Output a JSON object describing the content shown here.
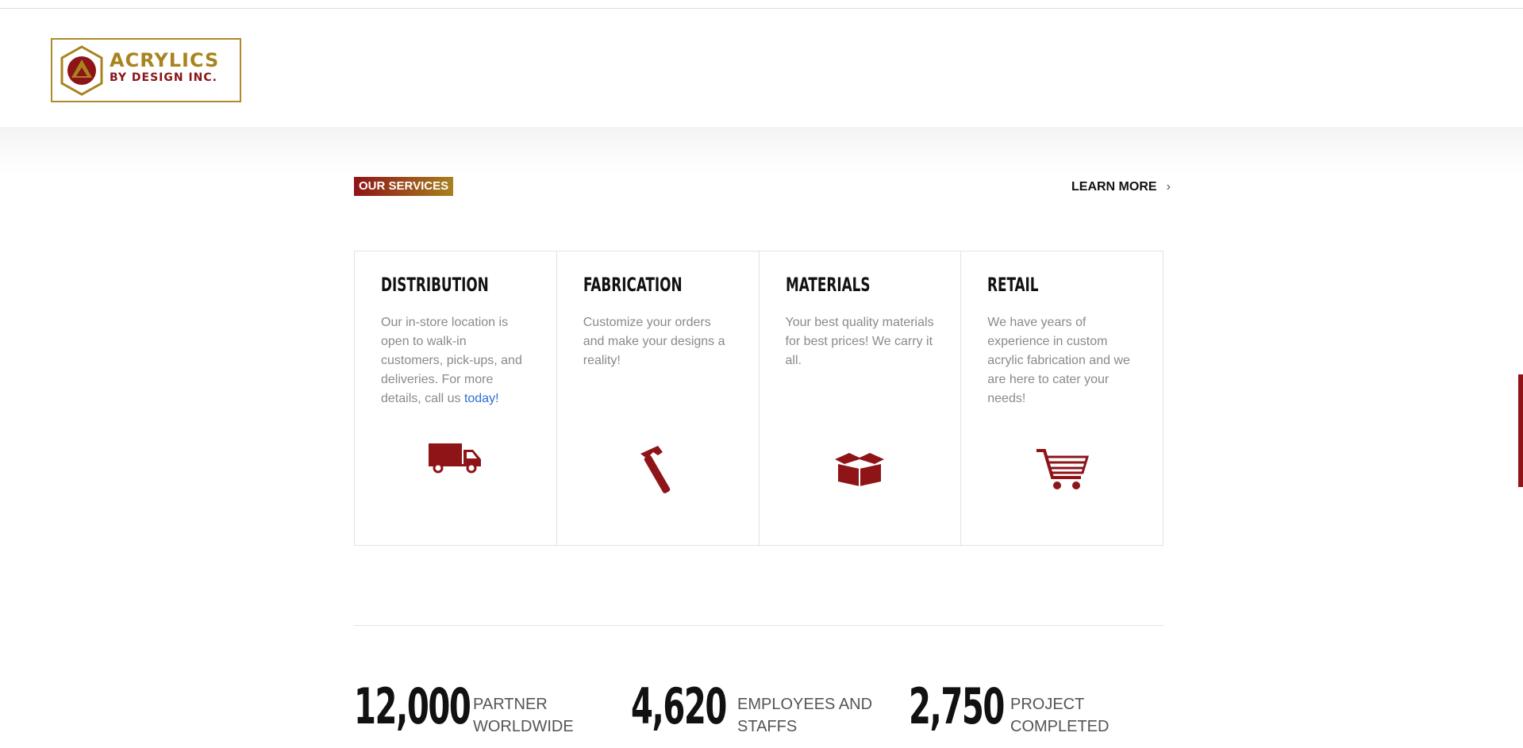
{
  "header": {
    "logo": {
      "line1": "ACRYLICS",
      "line2": "BY DESIGN INC."
    }
  },
  "services": {
    "badge": "OUR SERVICES",
    "learn_more": "LEARN MORE",
    "cards": [
      {
        "title": "DISTRIBUTION",
        "desc": "Our in-store location is open to walk-in customers, pick-ups, and deliveries. For more details, call us ",
        "link": "today!",
        "icon": "truck-icon"
      },
      {
        "title": "FABRICATION",
        "desc": "Customize your orders and make your designs a reality!",
        "icon": "hammer-icon"
      },
      {
        "title": "MATERIALS",
        "desc": "Your best quality materials for best prices! We carry it all.",
        "icon": "box-icon"
      },
      {
        "title": "RETAIL",
        "desc": "We have years of experience in custom acrylic fabrication and we are here to cater your needs!",
        "icon": "cart-icon"
      }
    ]
  },
  "stats": [
    {
      "number": "12,000",
      "label": "PARTNER\nWORLDWIDE"
    },
    {
      "number": "4,620",
      "label": "EMPLOYEES AND\nSTAFFS"
    },
    {
      "number": "2,750",
      "label": "PROJECT\nCOMPLETED"
    }
  ],
  "colors": {
    "brand_red": "#8e1418",
    "brand_gold": "#a8841f",
    "link": "#2a6fd6"
  }
}
